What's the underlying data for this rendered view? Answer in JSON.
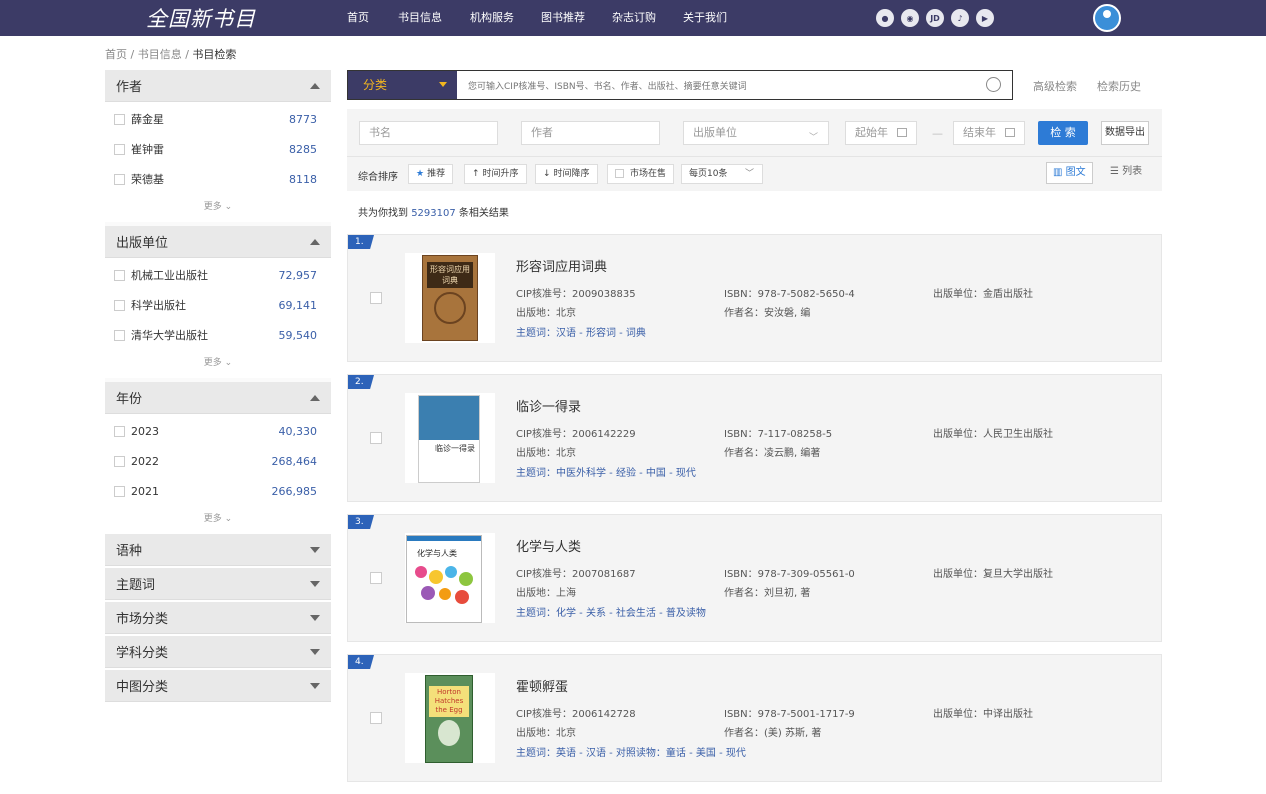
{
  "nav": {
    "logo": "全国新书目",
    "menu": [
      "首页",
      "书目信息",
      "机构服务",
      "图书推荐",
      "杂志订购",
      "关于我们"
    ],
    "social": [
      "WeChat",
      "Weibo",
      "JD",
      "TikTok",
      "Kuaishou"
    ]
  },
  "breadcrumb": [
    "首页",
    "书目信息",
    "书目检索"
  ],
  "filters": [
    {
      "title": "作者",
      "expanded": true,
      "items": [
        {
          "label": "薛金星",
          "count": "8773"
        },
        {
          "label": "崔钟雷",
          "count": "8285"
        },
        {
          "label": "荣德基",
          "count": "8118"
        }
      ],
      "more": "更多 ⌄"
    },
    {
      "title": "出版单位",
      "expanded": true,
      "items": [
        {
          "label": "机械工业出版社",
          "count": "72,957"
        },
        {
          "label": "科学出版社",
          "count": "69,141"
        },
        {
          "label": "清华大学出版社",
          "count": "59,540"
        }
      ],
      "more": "更多 ⌄"
    },
    {
      "title": "年份",
      "expanded": true,
      "items": [
        {
          "label": "2023",
          "count": "40,330"
        },
        {
          "label": "2022",
          "count": "268,464"
        },
        {
          "label": "2021",
          "count": "266,985"
        }
      ],
      "more": "更多 ⌄"
    },
    {
      "title": "语种",
      "expanded": false
    },
    {
      "title": "主题词",
      "expanded": false
    },
    {
      "title": "市场分类",
      "expanded": false
    },
    {
      "title": "学科分类",
      "expanded": false
    },
    {
      "title": "中图分类",
      "expanded": false
    }
  ],
  "search": {
    "category": "分类",
    "placeholder": "您可输入CIP核准号、ISBN号、书名、作者、出版社、摘要任意关键词",
    "advanced": "高级检索",
    "history": "检索历史"
  },
  "form": {
    "title_ph": "书名",
    "author_ph": "作者",
    "publisher_ph": "出版单位",
    "start_ph": "起始年",
    "end_ph": "结束年",
    "search_btn": "检 索",
    "export_btn": "数据导出"
  },
  "sort": {
    "label": "综合排序",
    "recommend": "推荐",
    "time_asc": "时间升序",
    "time_desc": "时间降序",
    "on_sale": "市场在售",
    "per_page": "每页10条",
    "view_image": "图文",
    "view_list": "列表"
  },
  "result_summary": {
    "prefix": "共为你找到",
    "count": "5293107",
    "suffix": "条相关结果"
  },
  "books": [
    {
      "num": "1.",
      "title": "形容词应用词典",
      "cip_label": "CIP核准号：",
      "cip": "2009038835",
      "isbn_label": "ISBN：",
      "isbn": "978-7-5082-5650-4",
      "pub_label": "出版单位：",
      "publisher": "金盾出版社",
      "place_label": "出版地：",
      "place": "北京",
      "author_label": "作者名：",
      "author": "安汝磐, 编",
      "kw_label": "主题词：",
      "keywords": "汉语 - 形容词 - 词典",
      "cover_text": "形容词应用词典"
    },
    {
      "num": "2.",
      "title": "临诊一得录",
      "cip_label": "CIP核准号：",
      "cip": "2006142229",
      "isbn_label": "ISBN：",
      "isbn": "7-117-08258-5",
      "pub_label": "出版单位：",
      "publisher": "人民卫生出版社",
      "place_label": "出版地：",
      "place": "北京",
      "author_label": "作者名：",
      "author": "凌云鹏, 编著",
      "kw_label": "主题词：",
      "keywords": "中医外科学 - 经验 - 中国 - 现代",
      "cover_text": "临诊一得录"
    },
    {
      "num": "3.",
      "title": "化学与人类",
      "cip_label": "CIP核准号：",
      "cip": "2007081687",
      "isbn_label": "ISBN：",
      "isbn": "978-7-309-05561-0",
      "pub_label": "出版单位：",
      "publisher": "复旦大学出版社",
      "place_label": "出版地：",
      "place": "上海",
      "author_label": "作者名：",
      "author": "刘旦初, 著",
      "kw_label": "主题词：",
      "keywords": "化学 - 关系 - 社会生活 - 普及读物",
      "cover_text": "化学与人类"
    },
    {
      "num": "4.",
      "title": "霍顿孵蛋",
      "cip_label": "CIP核准号：",
      "cip": "2006142728",
      "isbn_label": "ISBN：",
      "isbn": "978-7-5001-1717-9",
      "pub_label": "出版单位：",
      "publisher": "中译出版社",
      "place_label": "出版地：",
      "place": "北京",
      "author_label": "作者名：",
      "author": "(美) 苏斯, 著",
      "kw_label": "主题词：",
      "keywords": "英语 - 汉语 - 对照读物：童话 - 美国 - 现代",
      "cover_text": "Horton Hatches the Egg"
    }
  ],
  "colors": {
    "nav": "#3c3b66",
    "accent": "#f2b61f",
    "link": "#3a5fa8",
    "primary": "#2d7bd6"
  }
}
